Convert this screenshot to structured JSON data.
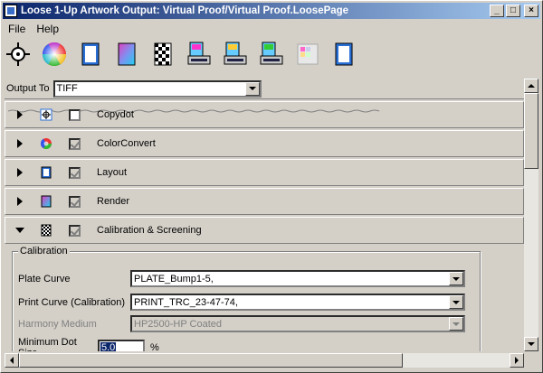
{
  "window": {
    "title": "Loose 1-Up Artwork Output: Virtual Proof/Virtual Proof.LoosePage",
    "controls": {
      "minimize": "_",
      "maximize": "□",
      "close": "×"
    }
  },
  "menu": {
    "items": [
      "File",
      "Help"
    ]
  },
  "toolbar": {
    "buttons": [
      {
        "icon": "copydot-target-icon"
      },
      {
        "icon": "color-wheel-icon"
      },
      {
        "icon": "layout-page-icon"
      },
      {
        "icon": "render-gradient-icon"
      },
      {
        "icon": "screening-checker-icon"
      },
      {
        "icon": "output-printer-1-icon"
      },
      {
        "icon": "output-printer-2-icon"
      },
      {
        "icon": "output-printer-3-icon"
      },
      {
        "icon": "proof-disabled-icon"
      },
      {
        "icon": "page-blue-icon"
      }
    ]
  },
  "output_to": {
    "label": "Output To",
    "value": "TIFF"
  },
  "sections": [
    {
      "label": "Copydot",
      "expanded": false,
      "checked": false,
      "icon": "copydot-icon"
    },
    {
      "label": "ColorConvert",
      "expanded": false,
      "checked": true,
      "icon": "colorconvert-icon"
    },
    {
      "label": "Layout",
      "expanded": false,
      "checked": true,
      "icon": "layout-icon"
    },
    {
      "label": "Render",
      "expanded": false,
      "checked": true,
      "icon": "render-icon"
    },
    {
      "label": "Calibration & Screening",
      "expanded": true,
      "checked": true,
      "icon": "screening-icon"
    }
  ],
  "calibration": {
    "group_title": "Calibration",
    "plate_curve": {
      "label": "Plate Curve",
      "value": "PLATE_Bump1-5,"
    },
    "print_curve": {
      "label": "Print Curve (Calibration)",
      "value": "PRINT_TRC_23-47-74,"
    },
    "harmony_medium": {
      "label": "Harmony Medium",
      "value": "HP2500-HP Coated",
      "disabled": true
    },
    "min_dot": {
      "label": "Minimum Dot Size",
      "value": "5.0",
      "unit": "%"
    }
  },
  "colors": {
    "title_start": "#0a246a",
    "title_end": "#a6caf0",
    "face": "#d4d0c8",
    "selection": "#0a246a"
  }
}
